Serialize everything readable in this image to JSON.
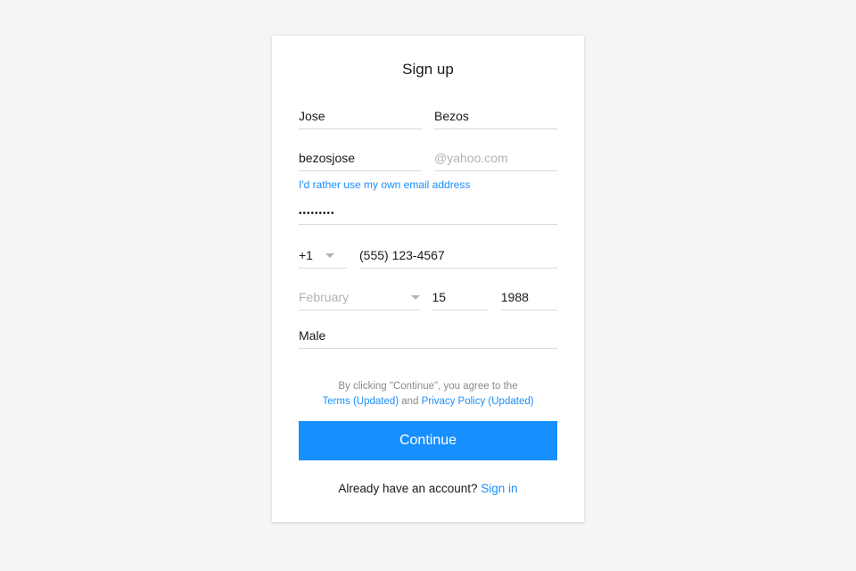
{
  "title": "Sign up",
  "firstName": "Jose",
  "lastName": "Bezos",
  "emailLocal": "bezosjose",
  "emailDomain": "@yahoo.com",
  "ownEmailLink": "I'd rather use my own email address",
  "passwordMasked": "•••••••••",
  "countryCode": "+1",
  "phone": "(555) 123-4567",
  "birthMonth": "February",
  "birthDay": "15",
  "birthYear": "1988",
  "gender": "Male",
  "terms": {
    "prefix": "By clicking \"Continue\", you agree to the ",
    "termsLink": "Terms (Updated)",
    "and": " and ",
    "privacyLink": "Privacy Policy (Updated)"
  },
  "continueLabel": "Continue",
  "signinPrompt": "Already have an account? ",
  "signinLink": "Sign in"
}
